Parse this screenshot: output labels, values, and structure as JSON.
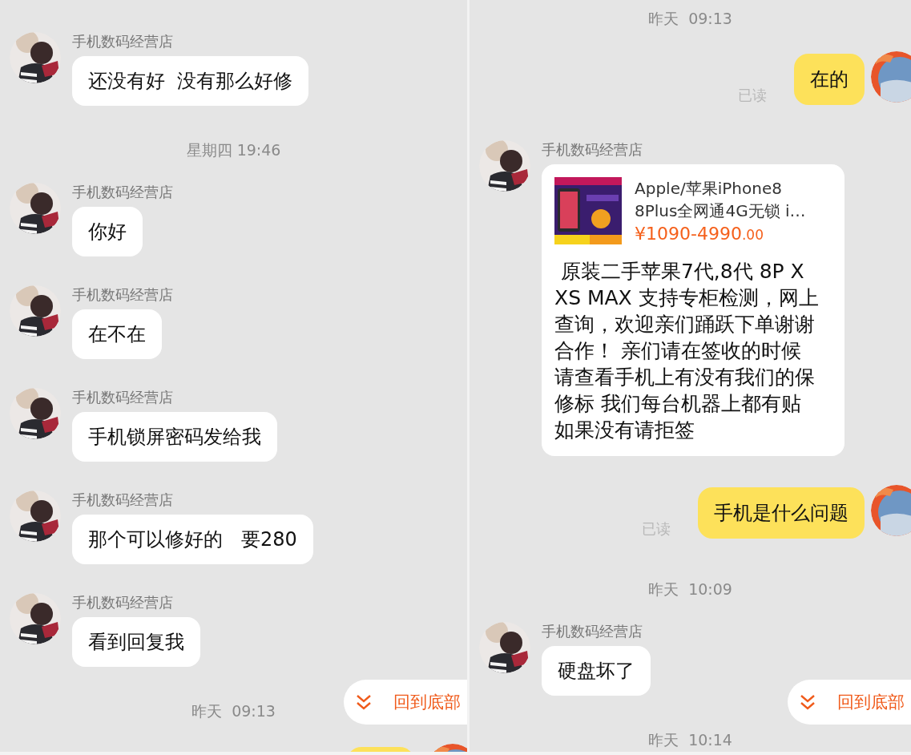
{
  "panels": [
    {
      "messages": [
        {
          "kind": "received",
          "sender": "手机数码经营店",
          "text": "还没有好  没有那么好修"
        },
        {
          "kind": "time",
          "text": "星期四 19:46"
        },
        {
          "kind": "received",
          "sender": "手机数码经营店",
          "text": "你好"
        },
        {
          "kind": "received",
          "sender": "手机数码经营店",
          "text": "在不在"
        },
        {
          "kind": "received",
          "sender": "手机数码经营店",
          "text": "手机锁屏密码发给我"
        },
        {
          "kind": "received",
          "sender": "手机数码经营店",
          "text": "那个可以修好的   要280"
        },
        {
          "kind": "received",
          "sender": "手机数码经营店",
          "text": "看到回复我"
        },
        {
          "kind": "time",
          "text": "昨天  09:13"
        },
        {
          "kind": "sent_cut"
        }
      ],
      "jump_button": {
        "label": "回到底部"
      }
    },
    {
      "messages": [
        {
          "kind": "time",
          "text": "昨天  09:13"
        },
        {
          "kind": "sent",
          "text": "在的",
          "status": "已读"
        },
        {
          "kind": "product_card",
          "sender": "手机数码经营店",
          "title_lines": [
            "Apple/苹果iPhone8",
            "8Plus全网通4G无锁 i…"
          ],
          "price": "¥1090-4990",
          "price_decimals": ".00",
          "text": " 原装二手苹果7代,8代 8P X XS MAX 支持专柜检测，网上查询，欢迎亲们踊跃下单谢谢合作！ 亲们请在签收的时候请查看手机上有没有我们的保修标 我们每台机器上都有贴如果没有请拒签"
        },
        {
          "kind": "sent",
          "text": "手机是什么问题",
          "status": "已读"
        },
        {
          "kind": "time",
          "text": "昨天  10:09"
        },
        {
          "kind": "received",
          "sender": "手机数码经营店",
          "text": "硬盘坏了"
        },
        {
          "kind": "time",
          "text": "昨天  10:14"
        }
      ],
      "jump_button": {
        "label": "回到底部"
      }
    }
  ]
}
